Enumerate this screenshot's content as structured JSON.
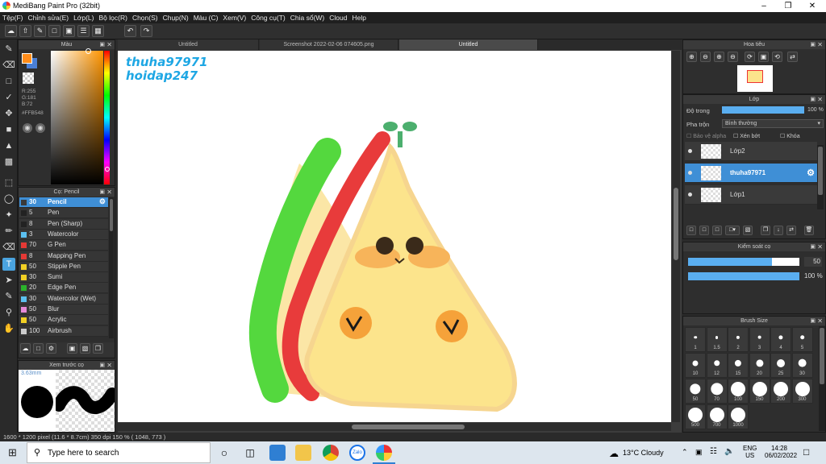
{
  "window": {
    "title": "MediBang Paint Pro (32bit)"
  },
  "menu": [
    "Tệp(F)",
    "Chỉnh sửa(E)",
    "Lớp(L)",
    "Bộ lọc(R)",
    "Chọn(S)",
    "Chụp(N)",
    "Màu (C)",
    "Xem(V)",
    "Công cụ(T)",
    "Chia sổ(W)",
    "Cloud",
    "Help"
  ],
  "color_panel": {
    "title": "Màu",
    "r": "R:255",
    "g": "G:181",
    "b": "B:72",
    "hex": "#FFB548",
    "fg_color": "#ff8c1a",
    "bg_color": "#4a7fd6"
  },
  "brush_panel": {
    "title": "Cọ: Pencil",
    "items": [
      {
        "size": "30",
        "name": "Pencil",
        "color": "#3a3a3a",
        "selected": true
      },
      {
        "size": "5",
        "name": "Pen",
        "color": "#222222"
      },
      {
        "size": "8",
        "name": "Pen (Sharp)",
        "color": "#222222"
      },
      {
        "size": "3",
        "name": "Watercolor",
        "color": "#5bc0f0"
      },
      {
        "size": "70",
        "name": "G Pen",
        "color": "#e53935"
      },
      {
        "size": "8",
        "name": "Mapping Pen",
        "color": "#e53935"
      },
      {
        "size": "50",
        "name": "Stipple Pen",
        "color": "#f2d024"
      },
      {
        "size": "30",
        "name": "Sumi",
        "color": "#f2d024"
      },
      {
        "size": "20",
        "name": "Edge Pen",
        "color": "#2bb32b"
      },
      {
        "size": "30",
        "name": "Watercolor (Wet)",
        "color": "#5bc0f0"
      },
      {
        "size": "50",
        "name": "Blur",
        "color": "#e58ad8"
      },
      {
        "size": "50",
        "name": "Acrylic",
        "color": "#f2d024"
      },
      {
        "size": "100",
        "name": "Airbrush",
        "color": "#cccccc"
      }
    ]
  },
  "preview_panel": {
    "title": "Xem trước cọ",
    "size": "3.63mm"
  },
  "tabs": [
    "Untitled",
    "Screenshot 2022-02-06 074605.png",
    "Untitled"
  ],
  "canvas": {
    "watermark1": "thuha97971",
    "watermark2": "hoidap247"
  },
  "navigator": {
    "title": "Hoa tiêu"
  },
  "layers_panel": {
    "title": "Lớp",
    "opacity_label": "Độ trong",
    "opacity_value": "100 %",
    "blend_label": "Pha trộn",
    "blend_value": "Bình thường",
    "protect_alpha": "Bảo vệ alpha",
    "clip": "Xén bớt",
    "lock": "Khóa",
    "layers": [
      {
        "name": "Lớp2",
        "selected": false
      },
      {
        "name": "thuha97971",
        "selected": true
      },
      {
        "name": "Lớp1",
        "selected": false
      }
    ]
  },
  "control_panel": {
    "title": "Kiểm soát cọ",
    "size_value": "50",
    "opacity_value": "100 %",
    "size_fraction": 0.75,
    "opacity_fraction": 1.0
  },
  "brush_size_panel": {
    "title": "Brush Size",
    "sizes": [
      "1",
      "1.5",
      "2",
      "3",
      "4",
      "5",
      "10",
      "12",
      "15",
      "20",
      "25",
      "30",
      "50",
      "70",
      "100",
      "150",
      "200",
      "300",
      "500",
      "700",
      "1000"
    ]
  },
  "status": {
    "text": "1600 * 1200 pixel   (11.6 * 8.7cm)   350 dpi   150 %   ( 1048, 773 )"
  },
  "taskbar": {
    "search_placeholder": "Type here to search",
    "weather": "13°C  Cloudy",
    "lang1": "ENG",
    "lang2": "US",
    "time": "14:28",
    "date": "06/02/2022"
  }
}
